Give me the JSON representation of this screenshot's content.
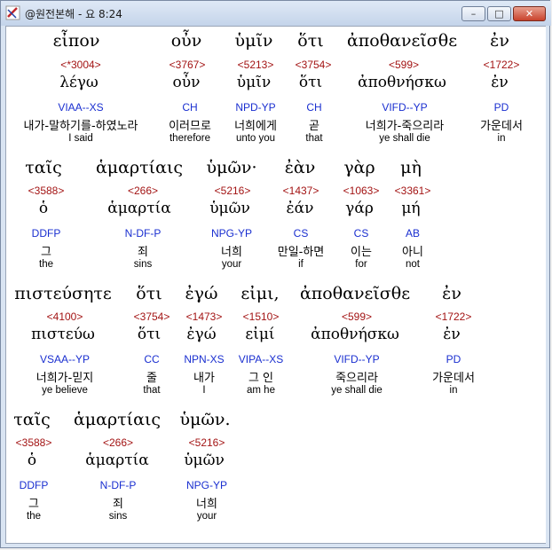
{
  "window": {
    "title": "@원전본해 - 요 8:24"
  },
  "buttons": {
    "minimize": "–",
    "maximize": "□",
    "close": "✕"
  },
  "rows": [
    {
      "words": [
        {
          "greek": "εἶπον",
          "num": "<*3004>",
          "lemma": "λέγω",
          "parse": "VIAA--XS",
          "kor": "내가-말하기를-하였노라",
          "eng": "I said"
        },
        {
          "greek": "οὖν",
          "num": "<3767>",
          "lemma": "οὖν",
          "parse": "CH",
          "kor": "이러므로",
          "eng": "therefore"
        },
        {
          "greek": "ὑμῖν",
          "num": "<5213>",
          "lemma": "ὑμῖν",
          "parse": "NPD-YP",
          "kor": "너희에게",
          "eng": "unto you"
        },
        {
          "greek": "ὅτι",
          "num": "<3754>",
          "lemma": "ὅτι",
          "parse": "CH",
          "kor": "곧",
          "eng": "that"
        },
        {
          "greek": "ἀποθανεῖσθε",
          "num": "<599>",
          "lemma": "ἀποθνήσκω",
          "parse": "VIFD--YP",
          "kor": "너희가-죽으리라",
          "eng": "ye shall die"
        },
        {
          "greek": "ἐν",
          "num": "<1722>",
          "lemma": "ἐν",
          "parse": "PD",
          "kor": "가운데서",
          "eng": "in"
        }
      ]
    },
    {
      "words": [
        {
          "greek": "ταῖς",
          "num": "<3588>",
          "lemma": "ὁ",
          "parse": "DDFP",
          "kor": "그",
          "eng": "the"
        },
        {
          "greek": "ἁμαρτίαις",
          "num": "<266>",
          "lemma": "ἁμαρτία",
          "parse": "N-DF-P",
          "kor": "죄",
          "eng": "sins"
        },
        {
          "greek": "ὑμῶν·",
          "num": "<5216>",
          "lemma": "ὑμῶν",
          "parse": "NPG-YP",
          "kor": "너희",
          "eng": "your"
        },
        {
          "greek": "ἐὰν",
          "num": "<1437>",
          "lemma": "ἐάν",
          "parse": "CS",
          "kor": "만일-하면",
          "eng": "if"
        },
        {
          "greek": "γὰρ",
          "num": "<1063>",
          "lemma": "γάρ",
          "parse": "CS",
          "kor": "이는",
          "eng": "for"
        },
        {
          "greek": "μὴ",
          "num": "<3361>",
          "lemma": "μή",
          "parse": "AB",
          "kor": "아니",
          "eng": "not"
        }
      ]
    },
    {
      "words": [
        {
          "greek": "πιστεύσητε",
          "num": "<4100>",
          "lemma": "πιστεύω",
          "parse": "VSAA--YP",
          "kor": "너희가-믿지",
          "eng": "ye believe"
        },
        {
          "greek": "ὅτι",
          "num": "<3754>",
          "lemma": "ὅτι",
          "parse": "CC",
          "kor": "줄",
          "eng": "that"
        },
        {
          "greek": "ἐγώ",
          "num": "<1473>",
          "lemma": "ἐγώ",
          "parse": "NPN-XS",
          "kor": "내가",
          "eng": "I"
        },
        {
          "greek": "εἰμι,",
          "num": "<1510>",
          "lemma": "εἰμί",
          "parse": "VIPA--XS",
          "kor": "그 인",
          "eng": "am he"
        },
        {
          "greek": "ἀποθανεῖσθε",
          "num": "<599>",
          "lemma": "ἀποθνήσκω",
          "parse": "VIFD--YP",
          "kor": "죽으리라",
          "eng": "ye shall die"
        },
        {
          "greek": "ἐν",
          "num": "<1722>",
          "lemma": "ἐν",
          "parse": "PD",
          "kor": "가운데서",
          "eng": "in"
        }
      ]
    },
    {
      "words": [
        {
          "greek": "ταῖς",
          "num": "<3588>",
          "lemma": "ὁ",
          "parse": "DDFP",
          "kor": "그",
          "eng": "the"
        },
        {
          "greek": "ἁμαρτίαις",
          "num": "<266>",
          "lemma": "ἁμαρτία",
          "parse": "N-DF-P",
          "kor": "죄",
          "eng": "sins"
        },
        {
          "greek": "ὑμῶν.",
          "num": "<5216>",
          "lemma": "ὑμῶν",
          "parse": "NPG-YP",
          "kor": "너희",
          "eng": "your"
        }
      ]
    }
  ]
}
